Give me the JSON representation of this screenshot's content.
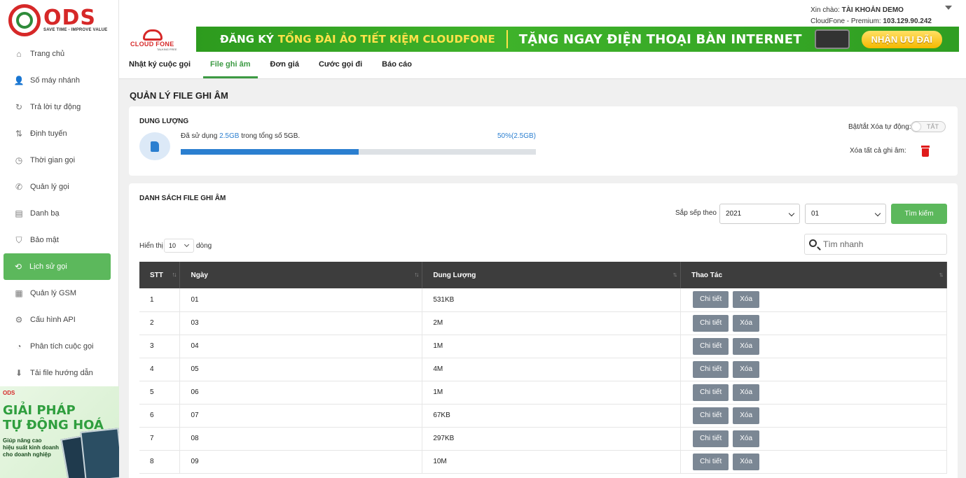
{
  "brand": {
    "logo_word": "ODS",
    "logo_tag": "SAVE TIME - IMPROVE VALUE"
  },
  "sidebar": {
    "items": [
      {
        "label": "Trang chủ",
        "icon": "home-icon",
        "glyph": "⌂"
      },
      {
        "label": "Số máy nhánh",
        "icon": "extension-user-icon",
        "glyph": "👤"
      },
      {
        "label": "Trả lời tự động",
        "icon": "refresh-icon",
        "glyph": "↻"
      },
      {
        "label": "Định tuyến",
        "icon": "signpost-icon",
        "glyph": "⇅"
      },
      {
        "label": "Thời gian gọi",
        "icon": "clock-icon",
        "glyph": "◷"
      },
      {
        "label": "Quản lý gọi",
        "icon": "phone-icon",
        "glyph": "✆"
      },
      {
        "label": "Danh bạ",
        "icon": "contacts-icon",
        "glyph": "▤"
      },
      {
        "label": "Bảo mật",
        "icon": "shield-icon",
        "glyph": "⛉"
      },
      {
        "label": "Lịch sử gọi",
        "icon": "history-icon",
        "glyph": "⟲",
        "active": true
      },
      {
        "label": "Quản lý GSM",
        "icon": "sim-icon",
        "glyph": "▦"
      },
      {
        "label": "Cấu hình API",
        "icon": "api-settings-icon",
        "glyph": "⚙"
      },
      {
        "label": "Phân tích cuộc gọi",
        "icon": "analytics-icon",
        "glyph": "◔"
      },
      {
        "label": "Tải file hướng dẫn",
        "icon": "download-icon",
        "glyph": "⬇"
      }
    ],
    "promo": {
      "logo": "ODS",
      "title_line1": "GIẢI PHÁP",
      "title_line2": "TỰ ĐỘNG HOÁ",
      "sub_line1": "Giúp nâng cao",
      "sub_line2": "hiệu suất kinh doanh",
      "sub_line3": "cho doanh nghiệp"
    }
  },
  "header": {
    "greeting_prefix": "Xin chào: ",
    "account_name": "TÀI KHOẢN DEMO",
    "plan_prefix": "CloudFone - Premium: ",
    "ip": "103.129.90.242"
  },
  "banner": {
    "cloudfone_logo": "CLOUD FONE",
    "cloudfone_sub": "TALKING FREE",
    "part1": "ĐĂNG KÝ",
    "part2": "TỔNG ĐÀI ẢO TIẾT KIỆM CLOUDFONE",
    "part3": "TẶNG NGAY ĐIỆN THOẠI BÀN INTERNET",
    "cta": "NHẬN ƯU ĐÃI"
  },
  "tabs": [
    {
      "label": "Nhật ký cuộc gọi"
    },
    {
      "label": "File ghi âm",
      "active": true
    },
    {
      "label": "Đơn giá"
    },
    {
      "label": "Cước gọi đi"
    },
    {
      "label": "Báo cáo"
    }
  ],
  "page_title": "QUẢN LÝ FILE GHI ÂM",
  "storage": {
    "heading": "DUNG LƯỢNG",
    "used_prefix": "Đã sử dụng ",
    "used_value": "2.5GB",
    "used_suffix": " trong tổng số 5GB.",
    "percent_text": "50%(2.5GB)",
    "percent_value": 0.5,
    "auto_delete_label": "Bật/tắt Xóa tự động:",
    "toggle_text": "TẮT",
    "delete_all_label": "Xóa tất cả ghi âm:"
  },
  "list": {
    "heading": "DANH SÁCH FILE GHI ÂM",
    "sort_label": "Sắp sếp theo",
    "year": "2021",
    "month": "01",
    "search_button": "Tìm kiếm",
    "show_label": "Hiển thị",
    "page_size": "10",
    "rows_label": "dòng",
    "quick_search_placeholder": "Tìm nhanh",
    "columns": [
      "STT",
      "Ngày",
      "Dung Lượng",
      "Thao Tác"
    ],
    "detail_label": "Chi tiết",
    "delete_label": "Xóa",
    "rows": [
      {
        "stt": "1",
        "day": "01",
        "size": "531KB"
      },
      {
        "stt": "2",
        "day": "03",
        "size": "2M"
      },
      {
        "stt": "3",
        "day": "04",
        "size": "1M"
      },
      {
        "stt": "4",
        "day": "05",
        "size": "4M"
      },
      {
        "stt": "5",
        "day": "06",
        "size": "1M"
      },
      {
        "stt": "6",
        "day": "07",
        "size": "67KB"
      },
      {
        "stt": "7",
        "day": "08",
        "size": "297KB"
      },
      {
        "stt": "8",
        "day": "09",
        "size": "10M"
      }
    ]
  },
  "colors": {
    "accent_green": "#5cb85c",
    "brand_red": "#d62828",
    "progress_blue": "#2b7fd0",
    "table_header": "#3d3d3d"
  }
}
